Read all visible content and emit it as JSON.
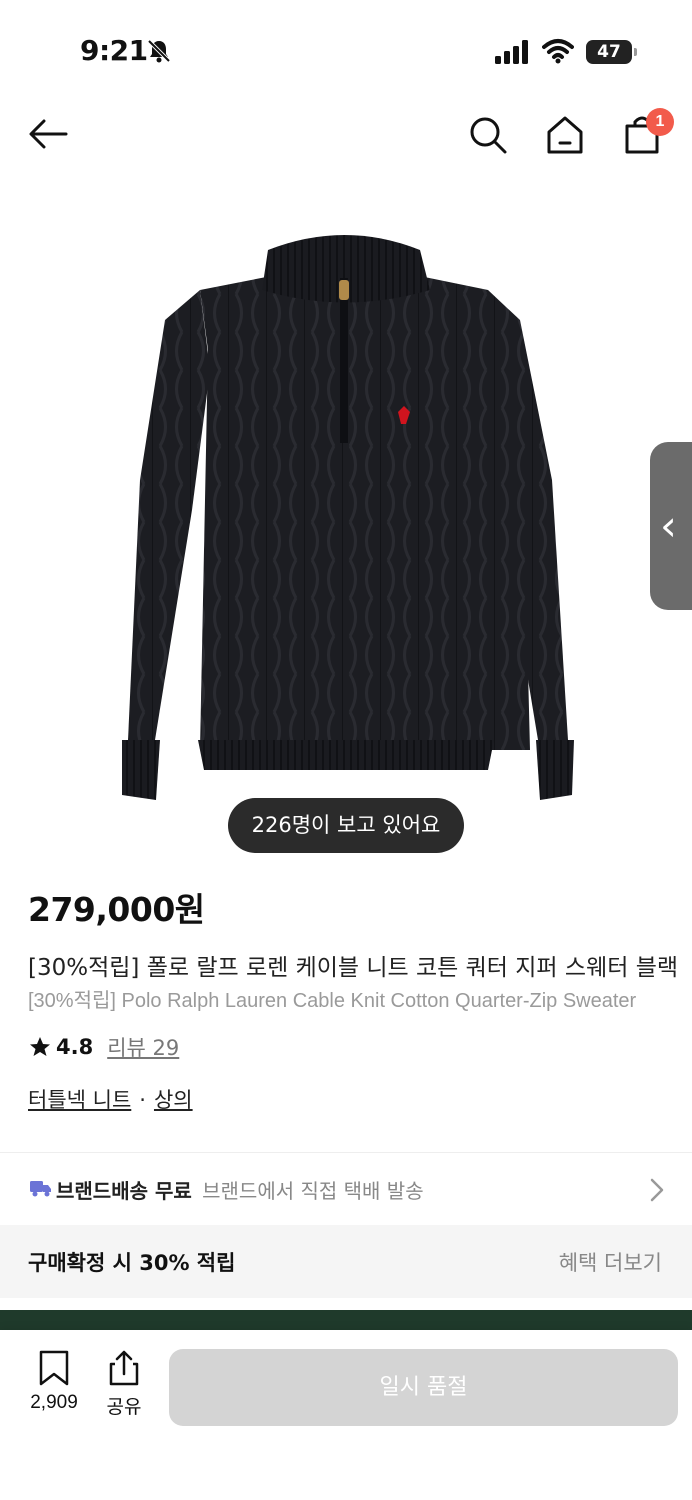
{
  "status_bar": {
    "time": "9:21",
    "battery": "47"
  },
  "nav": {
    "cart_badge": "1"
  },
  "product": {
    "viewers": "226명이 보고 있어요",
    "price": "279,000원",
    "title_ko": "[30%적립] 폴로 랄프 로렌 케이블 니트 코튼 쿼터 지퍼 스웨터 블랙",
    "title_en": "[30%적립] Polo Ralph Lauren Cable Knit Cotton Quarter-Zip Sweater",
    "rating": "4.8",
    "review_label": "리뷰 29",
    "category_1": "터틀넥 니트",
    "category_sep": "·",
    "category_2": "상의"
  },
  "shipping": {
    "label": "브랜드배송 무료",
    "sub": "브랜드에서 직접 택배 발송"
  },
  "benefit": {
    "label": "구매확정 시 30% 적립",
    "more": "혜택 더보기"
  },
  "bottom_bar": {
    "bookmark_count": "2,909",
    "share_label": "공유",
    "soldout_label": "일시 품절"
  },
  "colors": {
    "badge": "#f25b4b",
    "truck": "#6b73d6",
    "sweater": "#1c1d22",
    "logo": "#d0141e",
    "soldout_bg": "#d4d4d4"
  },
  "icons": [
    "bell-slash-icon",
    "signal-icon",
    "wifi-icon",
    "back-arrow-icon",
    "search-icon",
    "home-icon",
    "cart-icon",
    "star-icon",
    "truck-icon",
    "chevron-right-icon",
    "bookmark-icon",
    "share-icon",
    "chevron-left-icon"
  ]
}
